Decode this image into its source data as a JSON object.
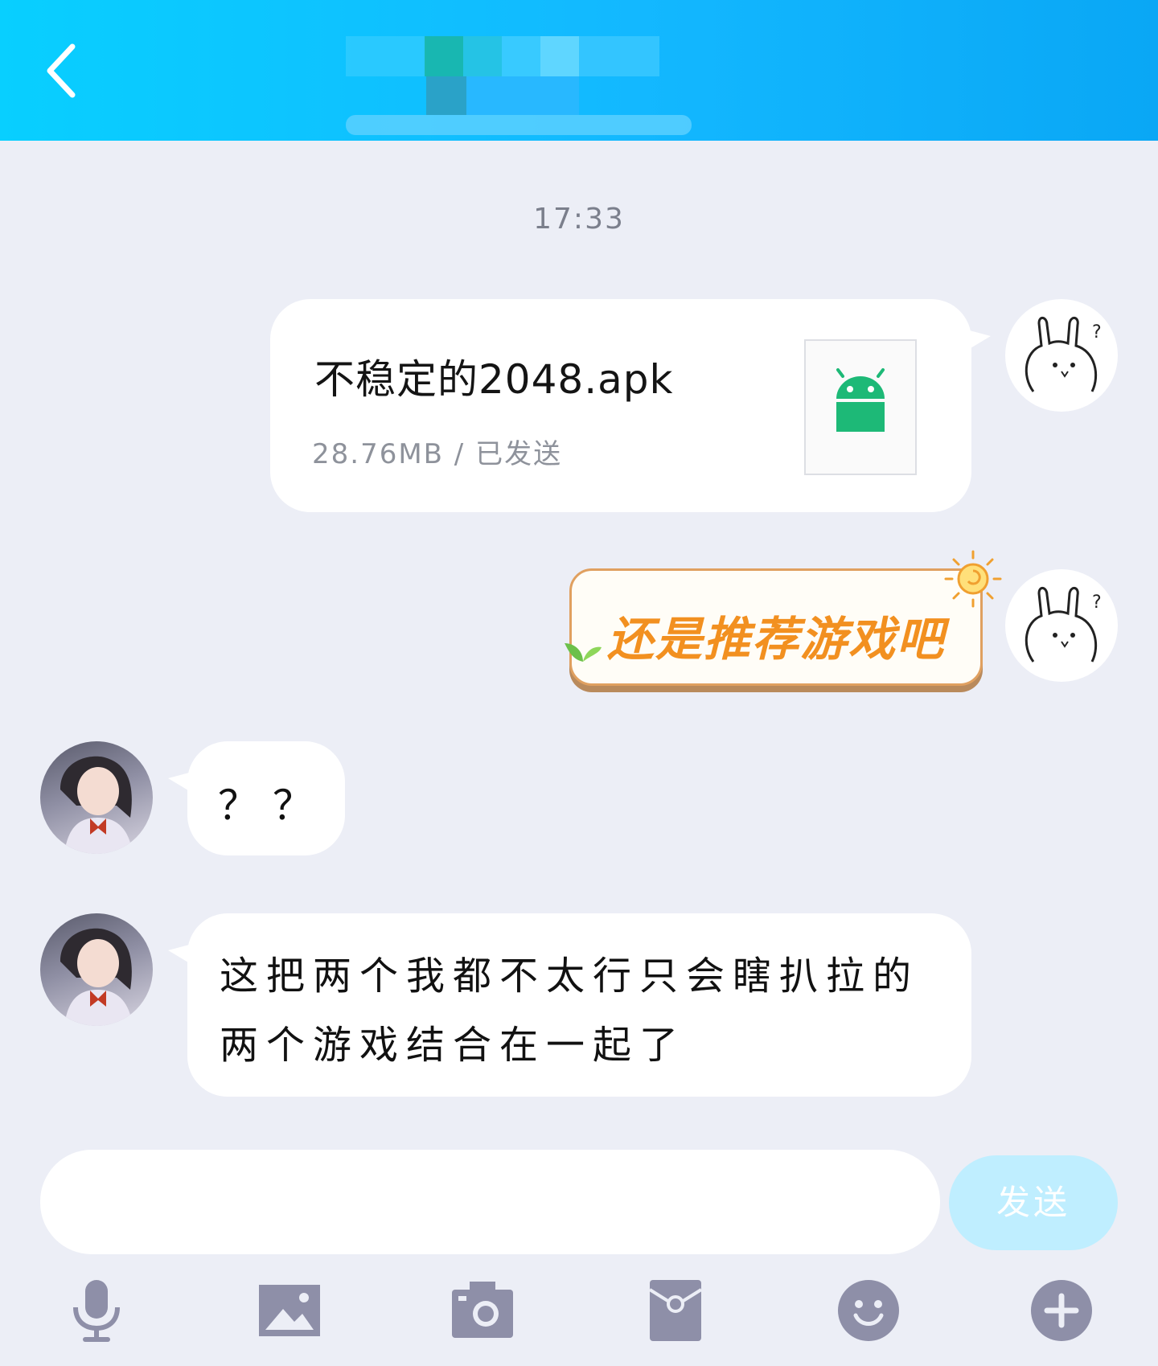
{
  "header": {
    "title": ""
  },
  "chat": {
    "timestamp": "17:33",
    "messages": [
      {
        "sender": "me",
        "type": "file",
        "file_name": "不稳定的2048.apk",
        "file_meta": "28.76MB / 已发送",
        "file_icon": "android-icon"
      },
      {
        "sender": "me",
        "type": "sticker",
        "text": "还是推荐游戏吧"
      },
      {
        "sender": "her",
        "type": "text",
        "text": "？？"
      },
      {
        "sender": "her",
        "type": "text",
        "lines": [
          "这把两个我都不太行只会瞎扒拉的",
          "两个游戏结合在一起了"
        ]
      }
    ]
  },
  "composer": {
    "placeholder": "",
    "send_label": "发送"
  },
  "toolbar": {
    "icons": [
      "microphone-icon",
      "image-icon",
      "camera-icon",
      "red-packet-icon",
      "emoji-icon",
      "plus-icon"
    ]
  },
  "colors": {
    "header_start": "#08cfff",
    "header_end": "#0aa7f5",
    "background": "#eceef6",
    "icon_gray": "#8e8fa8",
    "android_green": "#1db977",
    "sticker_text": "#f29020"
  }
}
